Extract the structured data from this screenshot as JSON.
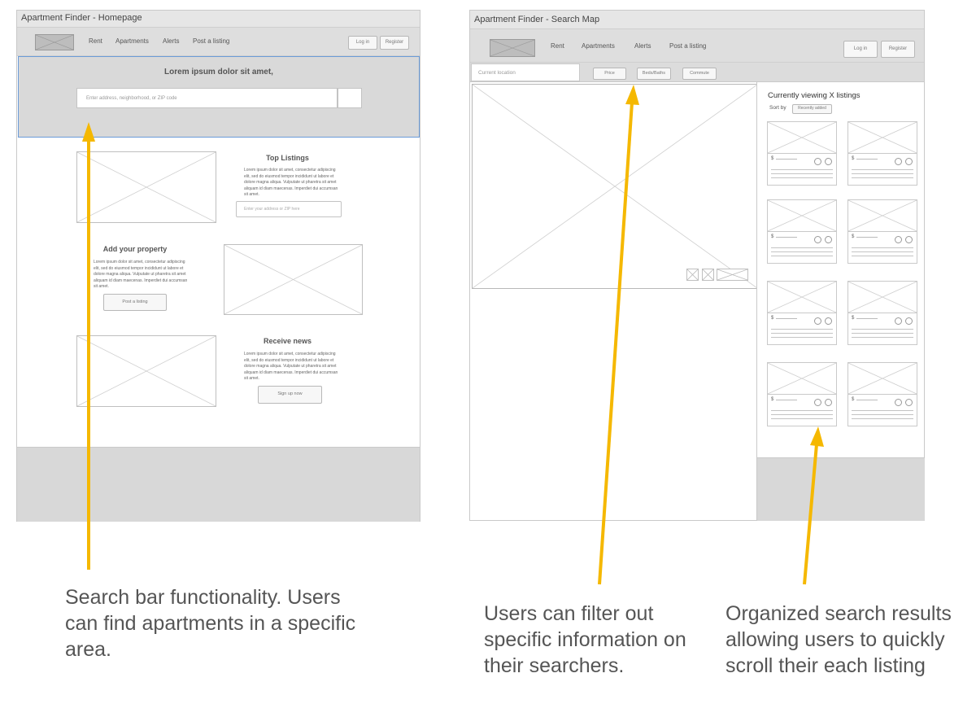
{
  "homepage": {
    "window_title": "Apartment Finder - Homepage",
    "nav": [
      "Rent",
      "Apartments",
      "Alerts",
      "Post a listing"
    ],
    "login": "Log in",
    "register": "Register",
    "hero_title": "Lorem ipsum dolor sit amet,",
    "search_placeholder": "Enter address, neighborhood, or ZIP code",
    "top_listings": {
      "heading": "Top Listings",
      "body": "Lorem ipsum dolor sit amet, consectetur adipiscing elit, sed do eiusmod tempor incididunt ut labore et dolore magna aliqua. Vulputate ut pharetra sit amet aliquam id diam maecenas. Imperdiet dui accumsan sit amet.",
      "input_placeholder": "Enter your address or ZIP here"
    },
    "add_property": {
      "heading": "Add your property",
      "body": "Lorem ipsum dolor sit amet, consectetur adipiscing elit, sed do eiusmod tempor incididunt ut labore et dolore magna aliqua. Vulputate ut pharetra sit amet aliquam id diam maecenas. Imperdiet dui accumsan sit amet.",
      "button": "Post a listing"
    },
    "receive_news": {
      "heading": "Receive news",
      "body": "Lorem ipsum dolor sit amet, consectetur adipiscing elit, sed do eiusmod tempor incididunt ut labore et dolore magna aliqua. Vulputate ut pharetra sit amet aliquam id diam maecenas. Imperdiet dui accumsan sit amet.",
      "button": "Sign up now"
    }
  },
  "searchmap": {
    "window_title": "Apartment Finder - Search Map",
    "nav": [
      "Rent",
      "Apartments",
      "Alerts",
      "Post a listing"
    ],
    "login": "Log in",
    "register": "Register",
    "location_placeholder": "Current location",
    "filters": [
      "Price",
      "Beds/Baths",
      "Commute"
    ],
    "results_title": "Currently viewing X listings",
    "sort_label": "Sort by",
    "sort_value": "Recently added",
    "listing_price_symbol": "$"
  },
  "annotations": {
    "search_bar": "Search bar functionality. Users can find apartments in a specific area.",
    "filters": "Users can filter out specific information on their searchers.",
    "results": "Organized search results allowing users to quickly scroll their each listing"
  },
  "colors": {
    "arrow": "#f5b800",
    "highlight": "#6a9bd8",
    "wire_gray": "#d8d8d8",
    "caption_text": "#555555"
  }
}
